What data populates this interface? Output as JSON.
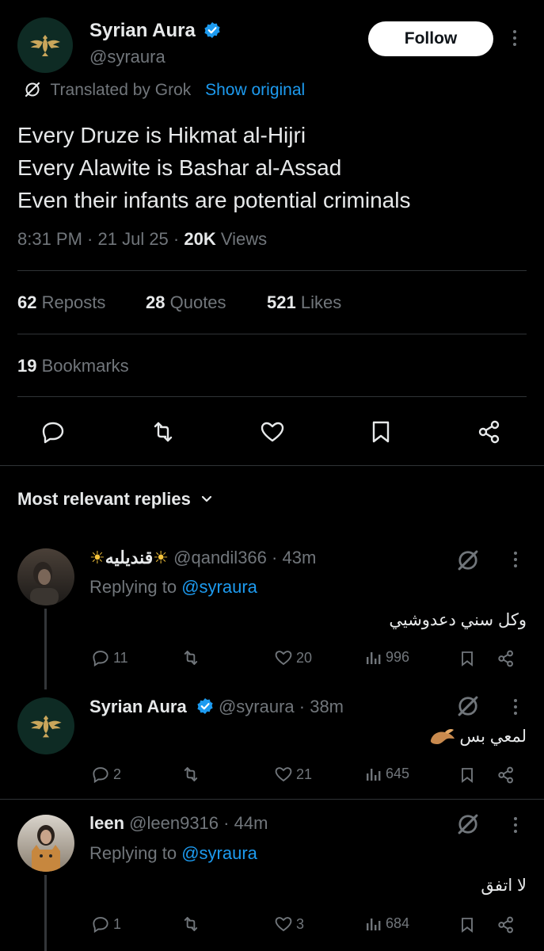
{
  "post": {
    "author_name": "Syrian Aura",
    "author_handle": "@syraura",
    "follow_label": "Follow",
    "translated_by": "Translated by Grok",
    "show_original": "Show original",
    "lines": [
      "Every Druze is Hikmat al-Hijri",
      "Every Alawite is Bashar al-Assad",
      "Even their infants are potential criminals"
    ],
    "time": "8:31 PM",
    "date": "21 Jul 25",
    "views_count": "20K",
    "views_label": "Views",
    "reposts_count": "62",
    "reposts_label": "Reposts",
    "quotes_count": "28",
    "quotes_label": "Quotes",
    "likes_count": "521",
    "likes_label": "Likes",
    "bookmarks_count": "19",
    "bookmarks_label": "Bookmarks"
  },
  "replies_header": "Most relevant replies",
  "replies": [
    {
      "name": "قنديليه",
      "handle": "@qandil366",
      "time": "43m",
      "replying_prefix": "Replying to",
      "replying_to": "@syraura",
      "text": "وكل سني دعدوشيي",
      "replies": "11",
      "likes": "20",
      "views": "996"
    },
    {
      "name": "Syrian Aura",
      "handle": "@syraura",
      "time": "38m",
      "text": "لمعي بس",
      "replies": "2",
      "likes": "21",
      "views": "645"
    },
    {
      "name": "leen",
      "handle": "@leen9316",
      "time": "44m",
      "replying_prefix": "Replying to",
      "replying_to": "@syraura",
      "text": "لا اتفق",
      "replies": "1",
      "likes": "3",
      "views": "684"
    }
  ],
  "colors": {
    "background": "#000000",
    "text": "#e7e9ea",
    "secondary": "#71767b",
    "link": "#1d9bf0",
    "divider": "#2f3336"
  }
}
